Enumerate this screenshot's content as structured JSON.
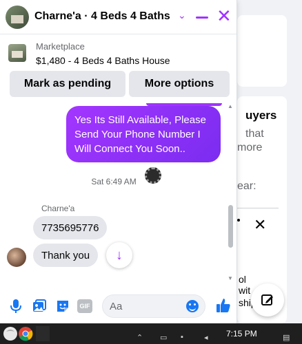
{
  "background": {
    "heading_partial": "uyers",
    "line1_partial": "that",
    "line2_partial": "more",
    "line3_partial": "ear:",
    "line4_partial": "ol",
    "line5_partial": "wit",
    "line6_partial": "ship"
  },
  "chat": {
    "title": "Charne'a · 4 Beds 4 Baths ...",
    "listing": {
      "label": "Marketplace",
      "title": "$1,480 - 4 Beds 4 Baths House"
    },
    "actions": {
      "mark_pending": "Mark as pending",
      "more_options": "More options"
    },
    "messages": {
      "outgoing": "Yes Its Still Available, Please Send Your Phone Number I Will Connect You Soon..",
      "timestamp": "Sat 6:49 AM",
      "sender": "Charne'a",
      "incoming": [
        "7735695776",
        "Thank you"
      ]
    },
    "composer": {
      "placeholder": "Aa",
      "gif_label": "GIF"
    },
    "accent_color": "#a033ff"
  },
  "taskbar": {
    "time": "7:15 PM"
  }
}
